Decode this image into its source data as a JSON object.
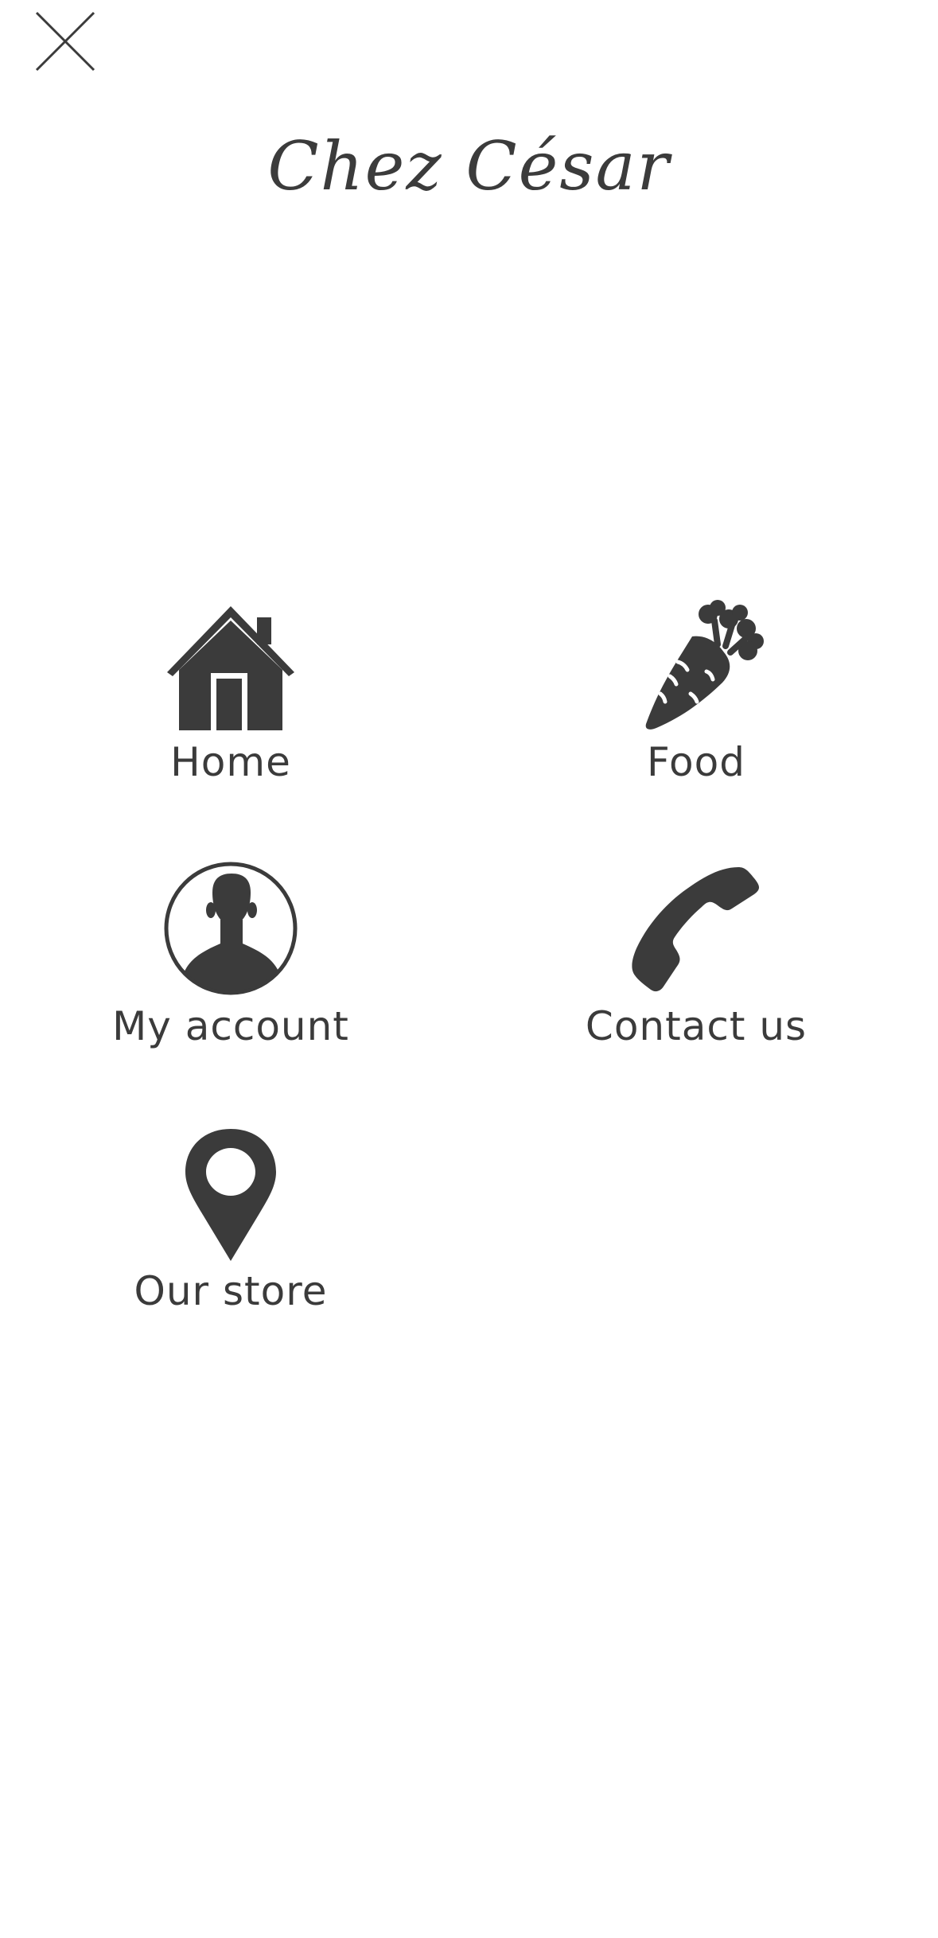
{
  "header": {
    "close_icon": "close-icon",
    "brand_title": "Chez César"
  },
  "menu": {
    "items": [
      {
        "label": "Home",
        "icon": "house-icon"
      },
      {
        "label": "Food",
        "icon": "carrot-icon"
      },
      {
        "label": "My account",
        "icon": "user-circle-icon"
      },
      {
        "label": "Contact us",
        "icon": "phone-icon"
      },
      {
        "label": "Our store",
        "icon": "location-pin-icon"
      }
    ]
  },
  "colors": {
    "icon": "#3b3b3b",
    "text": "#3b3b3b",
    "background": "#ffffff"
  }
}
